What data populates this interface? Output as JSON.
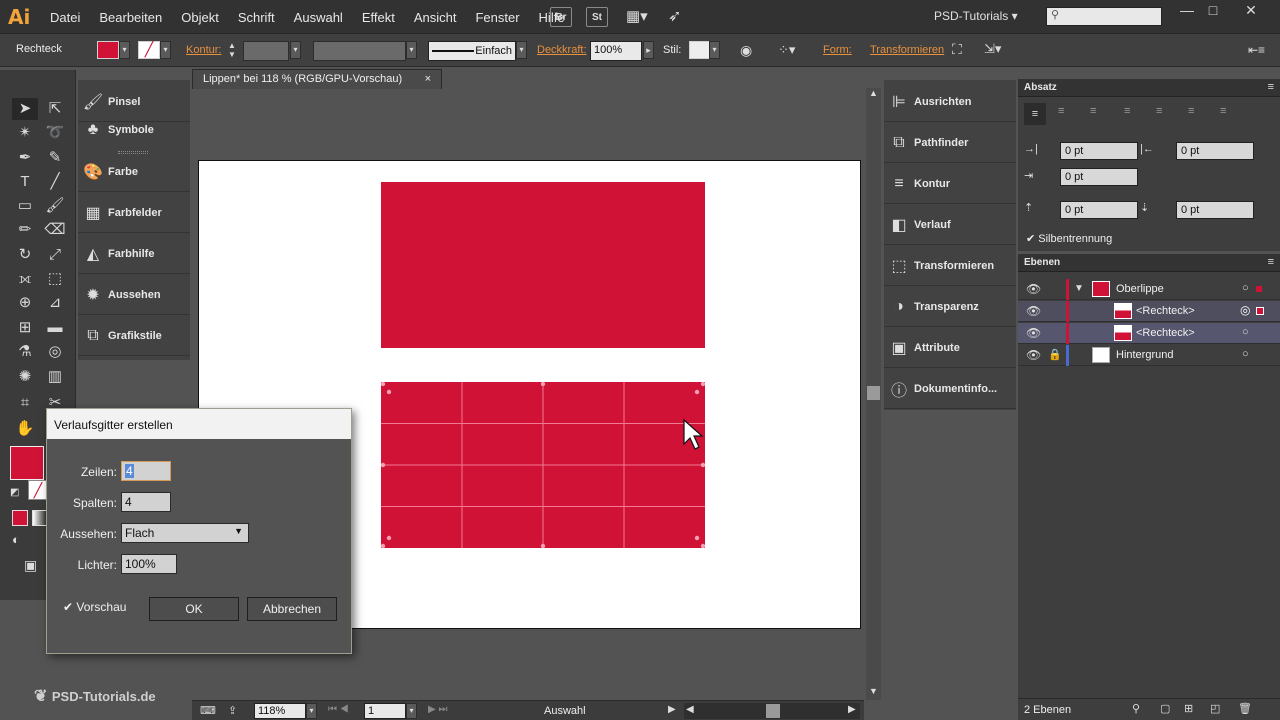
{
  "app": {
    "logo": "Ai",
    "menu": [
      "Datei",
      "Bearbeiten",
      "Objekt",
      "Schrift",
      "Auswahl",
      "Effekt",
      "Ansicht",
      "Fenster",
      "Hilfe"
    ],
    "bridge": "Br",
    "stock": "St",
    "workspace": "PSD-Tutorials"
  },
  "control": {
    "object_type": "Rechteck",
    "kontur_label": "Kontur:",
    "stroke_style": "Einfach",
    "deckkraft_label": "Deckkraft:",
    "opacity": "100%",
    "stil_label": "Stil:",
    "form_label": "Form:",
    "transform_label": "Transformieren",
    "fill_color": "#d01237"
  },
  "left_panels": [
    "Pinsel",
    "Symbole",
    "Farbe",
    "Farbfelder",
    "Farbhilfe",
    "Aussehen",
    "Grafikstile"
  ],
  "document": {
    "tab_title": "Lippen* bei 118 % (RGB/GPU-Vorschau)",
    "close": "×"
  },
  "status": {
    "zoom": "118%",
    "page": "1",
    "tool": "Auswahl"
  },
  "right_panels": [
    "Ausrichten",
    "Pathfinder",
    "Kontur",
    "Verlauf",
    "Transformieren",
    "Transparenz",
    "Attribute",
    "Dokumentinfo..."
  ],
  "absatz": {
    "title": "Absatz",
    "fields": [
      "0 pt",
      "0 pt",
      "0 pt",
      "0 pt",
      "0 pt"
    ],
    "hyphen": "Silbentrennung"
  },
  "ebenen": {
    "title": "Ebenen",
    "layers": [
      {
        "name": "Oberlippe"
      },
      {
        "name": "<Rechteck>"
      },
      {
        "name": "<Rechteck>"
      },
      {
        "name": "Hintergrund"
      }
    ],
    "count": "2 Ebenen"
  },
  "dialog": {
    "title": "Verlaufsgitter erstellen",
    "rows_label": "Zeilen:",
    "rows": "4",
    "cols_label": "Spalten:",
    "cols": "4",
    "look_label": "Aussehen:",
    "look": "Flach",
    "highlight_label": "Lichter:",
    "highlight": "100%",
    "preview": "Vorschau",
    "ok": "OK",
    "cancel": "Abbrechen"
  },
  "watermark": "PSD-Tutorials.de",
  "colors": {
    "accent": "#d01237",
    "link": "#e6913e"
  },
  "mesh_grid": {
    "rows": 4,
    "cols": 4
  }
}
